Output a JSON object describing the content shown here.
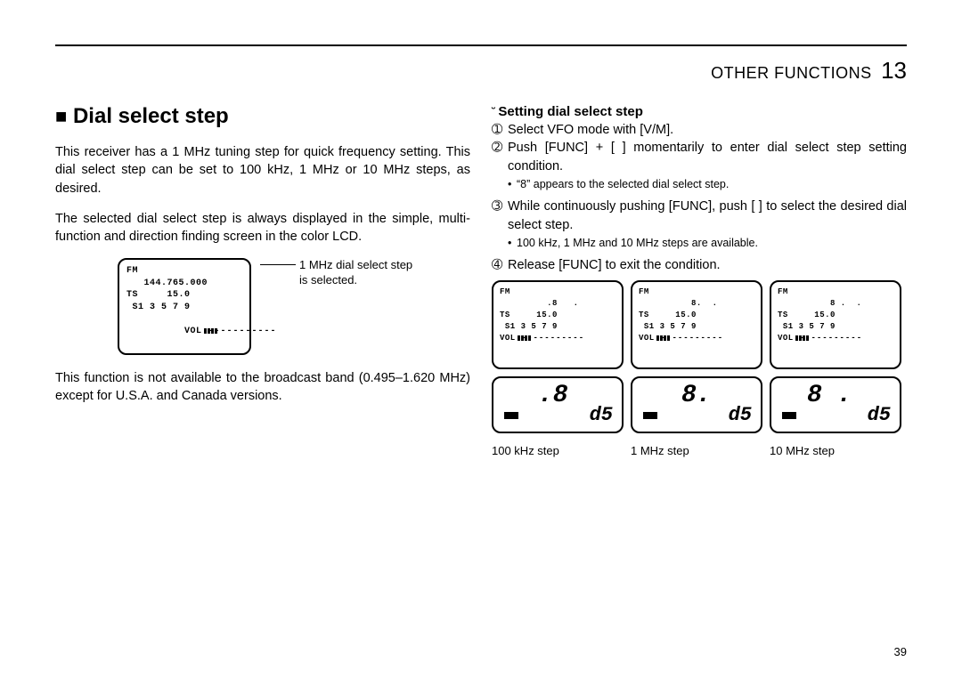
{
  "header": {
    "label": "OTHER FUNCTIONS",
    "chapter": "13"
  },
  "left": {
    "title_marker": "■",
    "title": "Dial select step",
    "p1": "This receiver has a 1 MHz tuning step for quick frequency setting. This dial select step can be set to 100 kHz, 1 MHz or 10 MHz steps, as desired.",
    "p2": "The selected dial select step is always displayed in the simple, multi-function and direction finding screen in the color LCD.",
    "caption1a": "1 MHz dial select step",
    "caption1b": "is selected.",
    "p3": "This function is not available to the broadcast band (0.495–1.620 MHz) except for U.S.A. and Canada versions.",
    "lcd": {
      "r1": "FM",
      "r2": "   144.765.000",
      "r3": "TS     15.0",
      "r4": " S1 3 5 7 9",
      "vol": "VOL",
      "dashes": "-----------"
    }
  },
  "right": {
    "sub_marker": "˘",
    "sub_title": "Setting dial select step",
    "s1m": "➀",
    "s1": "Select VFO mode with [V/M].",
    "s2m": "➁",
    "s2": "Push [FUNC] + [   ] momentarily to enter dial select step setting condition.",
    "b1": "“8” appears to the selected dial select step.",
    "s3m": "➂",
    "s3": "While continuously pushing [FUNC], push [   ] to select the desired dial select step.",
    "b2": "100 kHz, 1 MHz and 10 MHz steps are available.",
    "s4m": "➃",
    "s4": "Release [FUNC] to exit the condition.",
    "lcds": {
      "a": {
        "r1": "FM",
        "r2": "         .8   .",
        "r3": "TS     15.0",
        "r4": " S1 3 5 7 9",
        "big": ".8",
        "cap": "100 kHz step"
      },
      "b": {
        "r1": "FM",
        "r2": "          8.  .",
        "r3": "TS     15.0",
        "r4": " S1 3 5 7 9",
        "big": "8.",
        "cap": "1 MHz step"
      },
      "c": {
        "r1": "FM",
        "r2": "          8 .  .",
        "r3": "TS     15.0",
        "r4": " S1 3 5 7 9",
        "big": "8 .",
        "cap": "10 MHz step"
      }
    },
    "d5": "d5",
    "vol": "VOL",
    "dashes": "-----------"
  },
  "page": "39"
}
